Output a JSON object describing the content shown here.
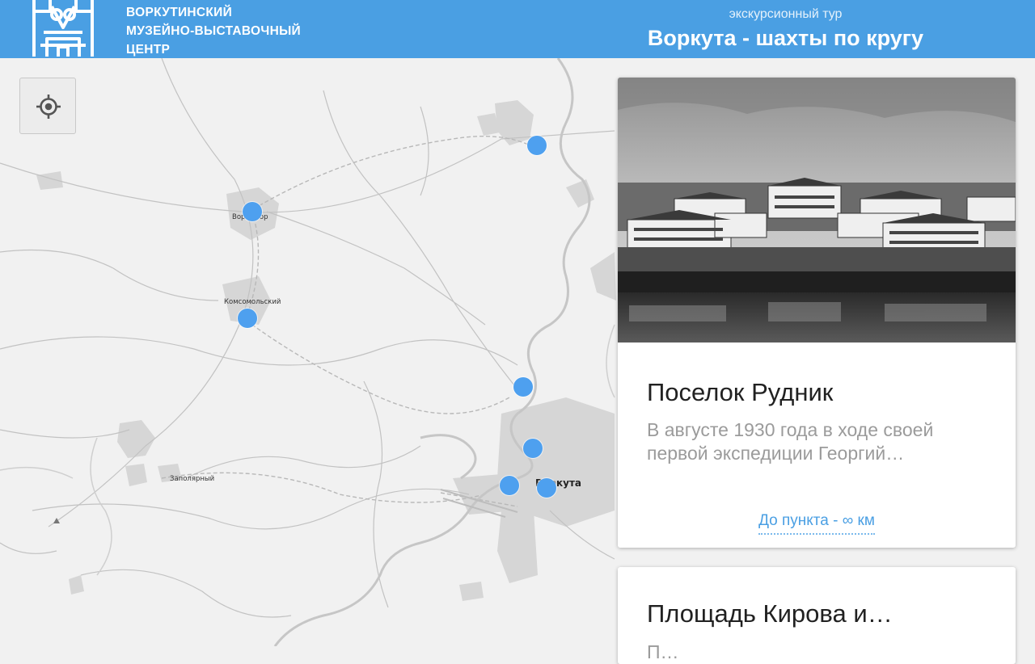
{
  "header": {
    "org_lines": [
      "ВОРКУТИНСКИЙ",
      "МУЗЕЙНО-ВЫСТАВОЧНЫЙ",
      "ЦЕНТР"
    ],
    "tour_subtitle": "экскурсионный тур",
    "tour_title": "Воркута - шахты по кругу"
  },
  "colors": {
    "header_bg": "#4a9fe3",
    "marker": "#4ea0ef",
    "link": "#4a9fe3"
  },
  "map": {
    "labels": {
      "vorgashor": "Воргашор",
      "komsomolsky": "Комсомольский",
      "zapolyarny": "Заполярный",
      "vorkuta": "Воркута"
    },
    "locate_button_icon": "crosshair-locate-icon",
    "marker_count": 8
  },
  "cards": [
    {
      "title": "Поселок Рудник",
      "description": "В августе 1930 года в ходе своей первой экспедиции Георгий…",
      "distance_link": "До пункта - ∞ км"
    },
    {
      "title": "Площадь Кирова и…",
      "description": "П…"
    }
  ]
}
